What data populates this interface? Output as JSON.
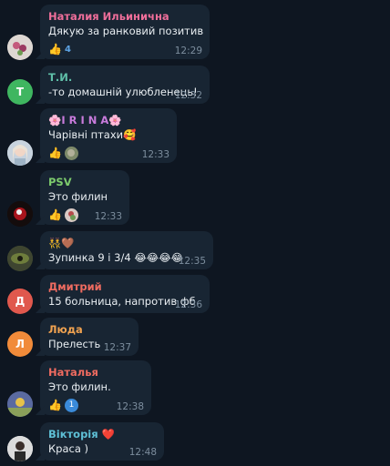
{
  "messages": [
    {
      "name": "Наталия Ильинична",
      "name_color": "#ee6e9a",
      "text": "Дякую за ранковий позитив",
      "time": "12:29",
      "reaction_count": "4"
    },
    {
      "name": "Т.И.",
      "name_color": "#5fbfa8",
      "avatar_letter": "Т",
      "avatar_color": "#3fb660",
      "text": "-то домашній улюбленець!",
      "time": "12:32"
    },
    {
      "name": "🌸I R I N A🌸",
      "name_color": "#c97bdc",
      "text": "Чарівні птахи🥰",
      "time": "12:33"
    },
    {
      "name": "PSV",
      "name_color": "#7dcb6d",
      "text": "Это филин",
      "time": "12:33"
    },
    {
      "name": "👯🤎",
      "name_color": "#5ea5e6",
      "text": "Зупинка 9 і 3/4 😂😂😂😂",
      "time": "12:35"
    },
    {
      "name": "Дмитрий",
      "name_color": "#ef6b60",
      "avatar_letter": "Д",
      "avatar_color": "#e0584d",
      "text": "15 больница, напротив фб",
      "time": "12:36"
    },
    {
      "name": "Люда",
      "name_color": "#f0a250",
      "avatar_letter": "Л",
      "avatar_color": "#f18b3a",
      "text": "Прелесть",
      "time": "12:37"
    },
    {
      "name": "Наталья",
      "name_color": "#ef6b60",
      "text": "Это филин.",
      "time": "12:38",
      "reaction_count": "1"
    },
    {
      "name": "Вікторія ❤️",
      "name_color": "#5ec0d6",
      "text": "Краса )",
      "time": "12:48"
    }
  ],
  "icons": {
    "thumbs_up": "👍"
  }
}
